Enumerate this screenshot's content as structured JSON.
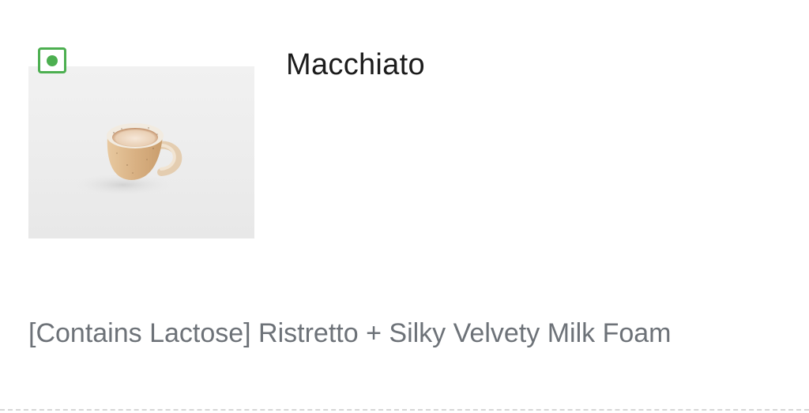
{
  "item": {
    "veg_indicator_icon": "veg-indicator-icon",
    "veg_indicator_color": "#4caf50",
    "image_icon": "coffee-cup-image",
    "title": "Macchiato",
    "description": "[Contains Lactose] Ristretto + Silky Velvety Milk Foam"
  }
}
